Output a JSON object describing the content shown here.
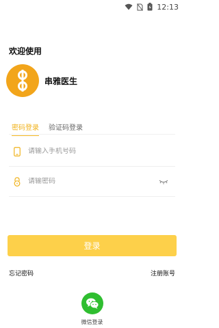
{
  "status_bar": {
    "time": "12:13"
  },
  "welcome_text": "欢迎使用",
  "brand": {
    "name": "串雅医生"
  },
  "tabs": [
    {
      "label": "密码登录",
      "active": true
    },
    {
      "label": "验证码登录",
      "active": false
    }
  ],
  "phone_field": {
    "placeholder": "请输入手机号码",
    "value": ""
  },
  "password_field": {
    "placeholder": "请输密码",
    "value": ""
  },
  "login_button": {
    "label": "登录"
  },
  "links": {
    "forgot": "忘记密码",
    "register": "注册账号"
  },
  "wechat_login": {
    "label": "微信登录"
  },
  "colors": {
    "accent": "#f0b21b",
    "button": "#fdd04a",
    "logo": "#f2a51b",
    "wechat": "#2fbe30"
  }
}
